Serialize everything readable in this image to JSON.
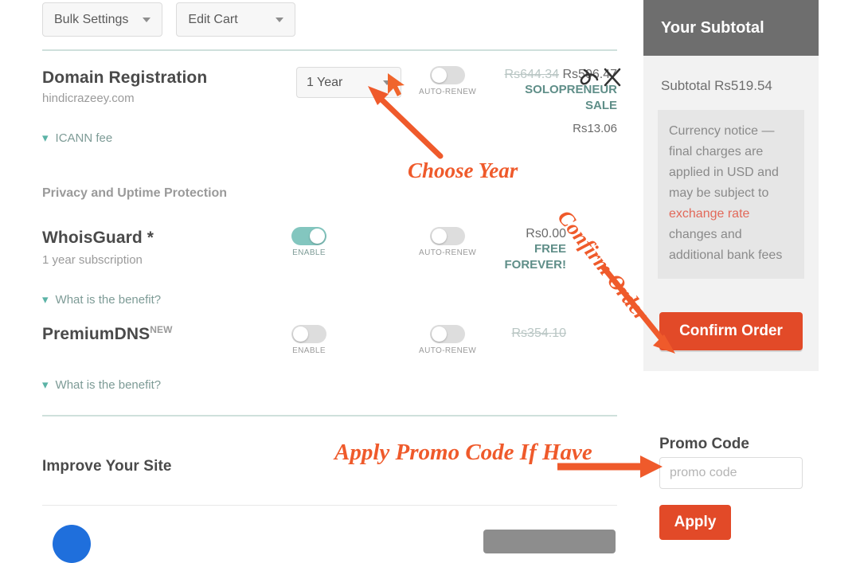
{
  "toolbar": {
    "bulk_settings_label": "Bulk Settings",
    "edit_cart_label": "Edit Cart"
  },
  "cart": {
    "domain": {
      "title": "Domain Registration",
      "name": "hindicrazeey.com",
      "icann_link": "ICANN fee",
      "term_selected": "1 Year",
      "auto_renew_label": "AUTO-RENEW",
      "price_old": "Rs644.34",
      "price_new": "Rs506.47",
      "promo_line1": "SOLOPRENEUR",
      "promo_line2": "SALE",
      "icann_price": "Rs13.06"
    },
    "privacy_section_label": "Privacy and Uptime Protection",
    "whoisguard": {
      "title": "WhoisGuard *",
      "subtitle": "1 year subscription",
      "benefit_link": "What is the benefit?",
      "enable_label": "ENABLE",
      "auto_renew_label": "AUTO-RENEW",
      "price": "Rs0.00",
      "tag_line1": "FREE",
      "tag_line2": "FOREVER!"
    },
    "premiumdns": {
      "title": "PremiumDNS",
      "badge": "NEW",
      "benefit_link": "What is the benefit?",
      "enable_label": "ENABLE",
      "auto_renew_label": "AUTO-RENEW",
      "price_old": "Rs354.10"
    },
    "improve_section_label": "Improve Your Site"
  },
  "sidebar": {
    "header_title": "Your Subtotal",
    "subtotal_line": "Subtotal Rs519.54",
    "notice_pre": "Currency notice — final charges are applied in USD and may be subject to ",
    "notice_link": "exchange rate",
    "notice_post": " changes and additional bank fees",
    "confirm_label": "Confirm Order",
    "promo_title": "Promo Code",
    "promo_placeholder": "promo code",
    "apply_label": "Apply"
  },
  "annotations": {
    "choose_year": "Choose Year",
    "confirm_order": "Confirm Order",
    "apply_promo": "Apply Promo Code If Have"
  },
  "colors": {
    "accent_orange": "#ef5a2b",
    "button_red": "#e24a28",
    "teal": "#83c6bf",
    "header_grey": "#6e6e6e"
  }
}
